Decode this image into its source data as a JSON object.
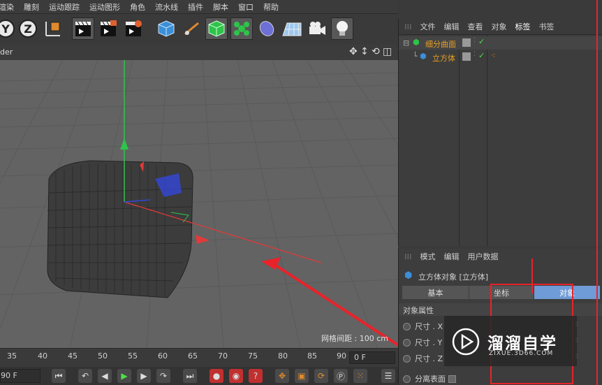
{
  "menu": [
    "渲染",
    "雕刻",
    "运动跟踪",
    "运动图形",
    "角色",
    "流水线",
    "插件",
    "脚本",
    "窗口",
    "帮助"
  ],
  "toolbar": {
    "axis_y": "Y",
    "axis_z": "Z"
  },
  "viewport": {
    "title_partial": "der",
    "grid_spacing": "网格间距 : 100 cm"
  },
  "timeline": {
    "ticks": [
      "35",
      "40",
      "45",
      "50",
      "55",
      "60",
      "65",
      "70",
      "75",
      "80",
      "85",
      "90"
    ],
    "current_frame": "0 F",
    "end_frame": "90 F"
  },
  "object_manager": {
    "tabs": [
      "文件",
      "编辑",
      "查看",
      "对象",
      "标签",
      "书签"
    ],
    "objects": [
      {
        "name": "细分曲面",
        "color": "#e8a020"
      },
      {
        "name": "立方体",
        "color": "#e8a020"
      }
    ]
  },
  "attributes": {
    "tabs": [
      "模式",
      "编辑",
      "用户数据"
    ],
    "object_title": "立方体对象 [立方体]",
    "sub_tabs": [
      "基本",
      "坐标",
      "对象"
    ],
    "section": "对象属性",
    "fields": [
      "尺寸 . X",
      "尺寸 . Y",
      "尺寸 . Z"
    ],
    "separate_faces": "分离表面"
  },
  "watermark": {
    "title": "溜溜自学",
    "url": "ZIXUE.3D66.COM"
  },
  "colors": {
    "accent_red": "#e8232a",
    "active_tab": "#6f9bd6",
    "viewport_bg": "#636363"
  }
}
